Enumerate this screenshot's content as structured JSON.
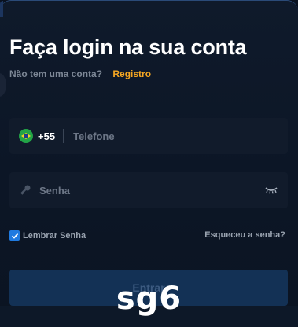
{
  "login": {
    "title": "Faça login na sua conta",
    "no_account_text": "Não tem uma conta?",
    "register_link": "Registro",
    "phone": {
      "country_code": "+55",
      "placeholder": "Telefone",
      "value": ""
    },
    "password": {
      "placeholder": "Senha",
      "value": ""
    },
    "remember_label": "Lembrar Senha",
    "remember_checked": true,
    "forgot_link": "Esqueceu a senha?",
    "submit_label": "Entrar"
  },
  "watermark": "sg6",
  "colors": {
    "accent": "#f5a623",
    "checkbox": "#1f7ae0",
    "button_bg": "#133155"
  },
  "icons": [
    "brazil-flag-icon",
    "key-icon",
    "eye-closed-icon",
    "checkmark-icon"
  ]
}
